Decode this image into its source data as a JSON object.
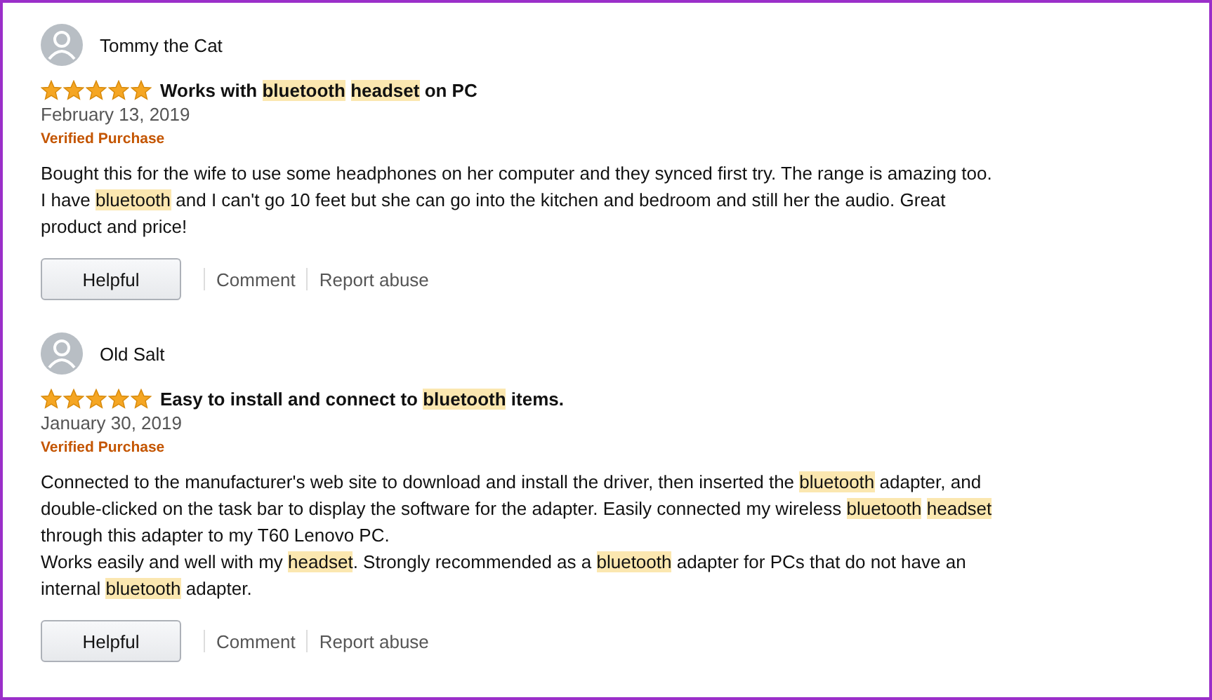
{
  "reviews": [
    {
      "author": "Tommy the Cat",
      "stars": 5,
      "title": "Works with *bluetooth* *headset* on PC",
      "date": "February 13, 2019",
      "badge": "Verified Purchase",
      "paragraphs": [
        "Bought this for the wife to use some headphones on her computer and they synced first try. The range is amazing too. I have *bluetooth* and I can't go 10 feet but she can go into the kitchen and bedroom and still her the audio. Great product and price!"
      ],
      "helpful": "Helpful",
      "comment": "Comment",
      "report": "Report abuse"
    },
    {
      "author": "Old Salt",
      "stars": 5,
      "title": "Easy to install and connect to *bluetooth* items.",
      "date": "January 30, 2019",
      "badge": "Verified Purchase",
      "paragraphs": [
        "Connected to the manufacturer's web site to download and install the driver, then inserted the *bluetooth* adapter, and double-clicked on the task bar to display the software for the adapter. Easily connected my wireless *bluetooth* *headset* through this adapter to my T60 Lenovo PC.",
        "Works easily and well with my *headset*. Strongly recommended as a *bluetooth* adapter for PCs that do not have an internal *bluetooth* adapter."
      ],
      "helpful": "Helpful",
      "comment": "Comment",
      "report": "Report abuse"
    }
  ]
}
